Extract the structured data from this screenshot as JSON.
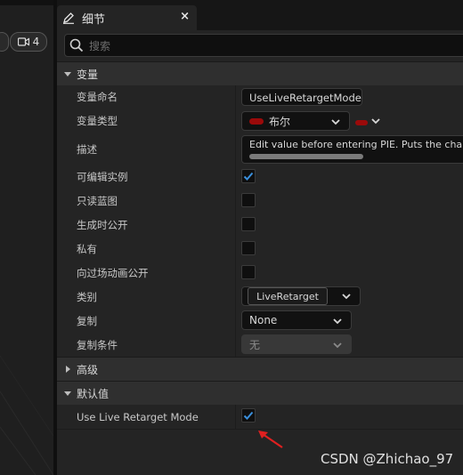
{
  "left_toolbar": {
    "camera_count": "4"
  },
  "tab": {
    "title": "细节",
    "close_glyph": "×"
  },
  "search": {
    "placeholder": "搜索"
  },
  "sections": {
    "variable": "变量",
    "advanced": "高级",
    "default_value": "默认值"
  },
  "rows": {
    "variable_name": {
      "label": "变量命名",
      "value": "UseLiveRetargetMode"
    },
    "variable_type": {
      "label": "变量类型",
      "value": "布尔",
      "type_color": "#9b0a0a"
    },
    "description": {
      "label": "描述",
      "value": "Edit value before entering PIE. Puts the characte"
    },
    "instance_editable": {
      "label": "可编辑实例",
      "checked": true
    },
    "blueprint_readonly": {
      "label": "只读蓝图",
      "checked": false
    },
    "expose_on_spawn": {
      "label": "生成时公开",
      "checked": false
    },
    "private": {
      "label": "私有",
      "checked": false
    },
    "expose_to_cinematics": {
      "label": "向过场动画公开",
      "checked": false
    },
    "category": {
      "label": "类别",
      "value": "LiveRetarget"
    },
    "replication": {
      "label": "复制",
      "value": "None"
    },
    "replication_condition": {
      "label": "复制条件",
      "value": "无"
    },
    "use_live_retarget_mode": {
      "label": "Use Live Retarget Mode",
      "checked": true
    }
  },
  "watermark": "CSDN @Zhichao_97",
  "colors": {
    "accent": "#3a8fdc",
    "annotation": "#e02020"
  }
}
